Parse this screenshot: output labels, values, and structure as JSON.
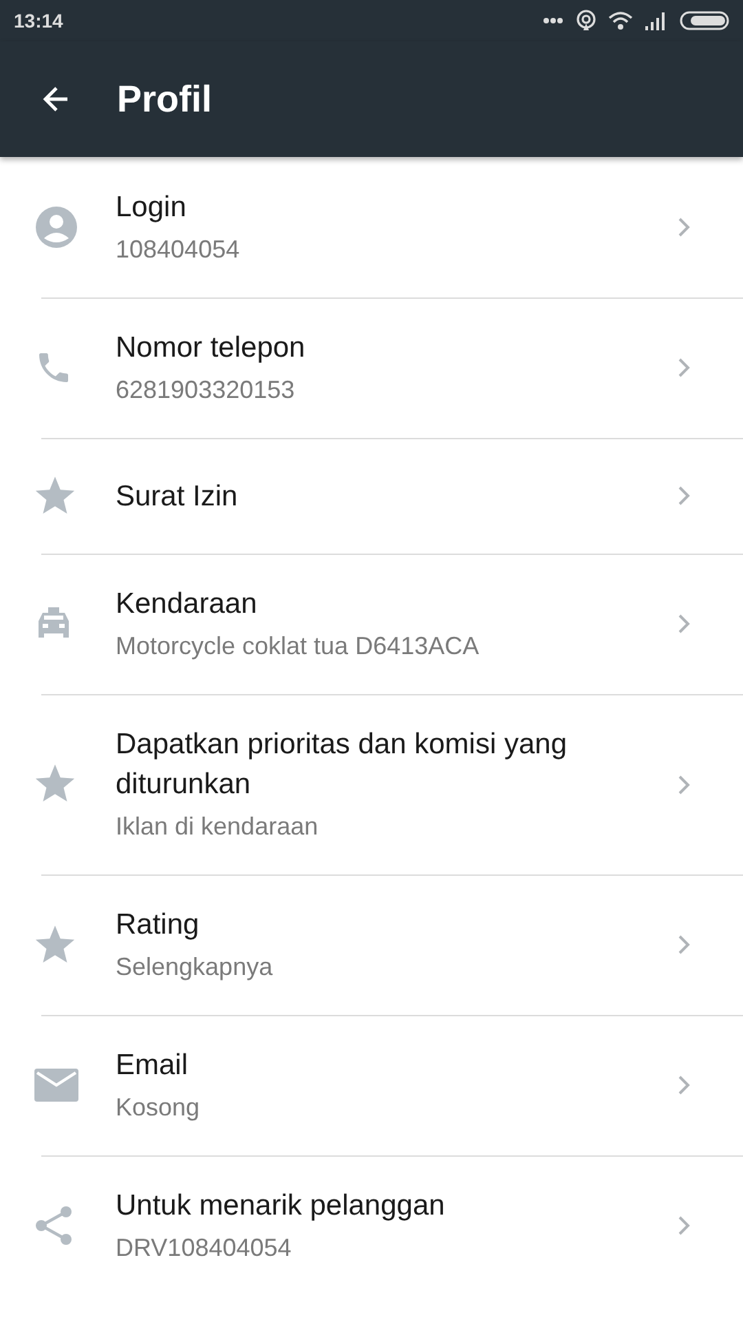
{
  "status_bar": {
    "time": "13:14"
  },
  "toolbar": {
    "title": "Profil"
  },
  "items": [
    {
      "kind": "person",
      "title": "Login",
      "subtitle": "108404054"
    },
    {
      "kind": "phone",
      "title": "Nomor telepon",
      "subtitle": "6281903320153"
    },
    {
      "kind": "star",
      "title": "Surat Izin"
    },
    {
      "kind": "taxi",
      "title": "Kendaraan",
      "subtitle": "Motorcycle coklat tua D6413ACA"
    },
    {
      "kind": "star",
      "title": "Dapatkan prioritas dan komisi yang diturunkan",
      "subtitle": "Iklan di kendaraan"
    },
    {
      "kind": "star",
      "title": "Rating",
      "subtitle": "Selengkapnya"
    },
    {
      "kind": "mail",
      "title": "Email",
      "subtitle": "Kosong"
    },
    {
      "kind": "share",
      "title": "Untuk menarik pelanggan",
      "subtitle": "DRV108404054"
    }
  ]
}
